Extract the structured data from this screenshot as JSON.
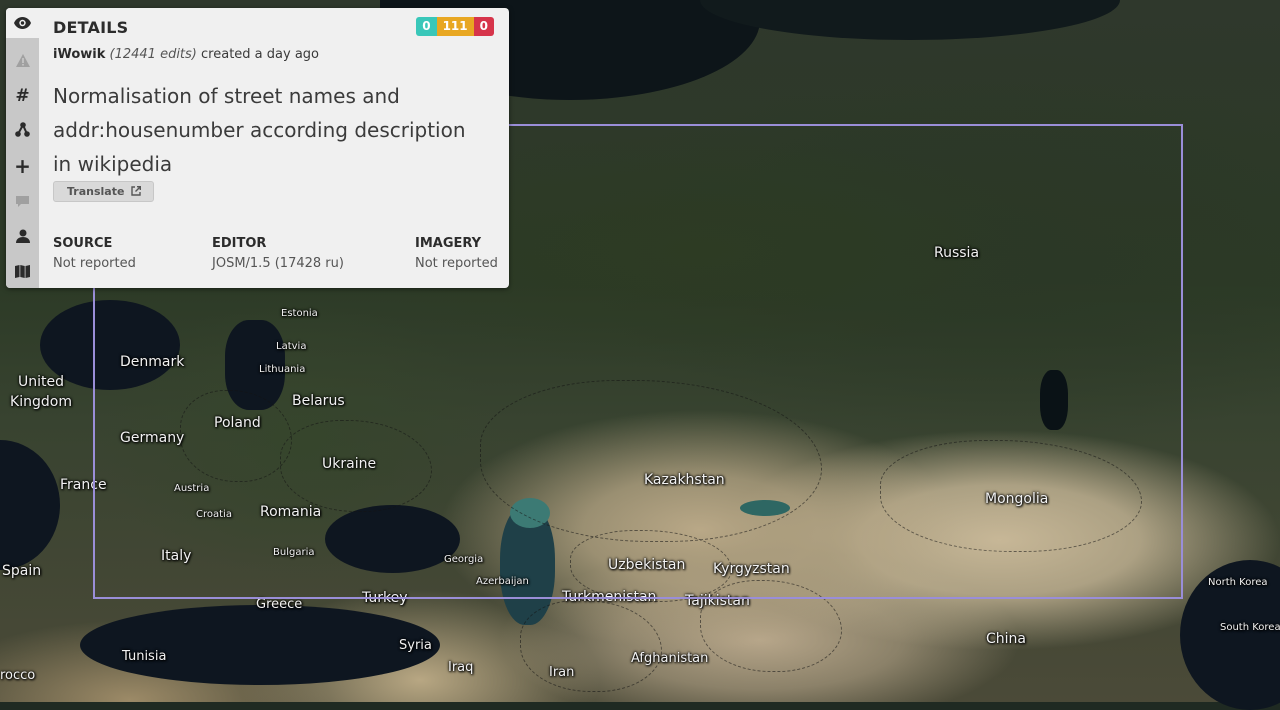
{
  "panel": {
    "title": "DETAILS",
    "badges": {
      "created": "0",
      "modified": "111",
      "deleted": "0"
    },
    "user": "iWowik",
    "edits": "(12441 edits)",
    "created_text": "created a day ago",
    "comment": "Normalisation of street names and addr:housenumber according description in wikipedia",
    "translate_label": "Translate",
    "source_label": "SOURCE",
    "source_value": "Not reported",
    "editor_label": "EDITOR",
    "editor_value": "JOSM/1.5 (17428 ru)",
    "imagery_label": "IMAGERY",
    "imagery_value": "Not reported"
  },
  "rail_icons": [
    "eye-icon",
    "warning-icon",
    "hashtag-icon",
    "geometry-icon",
    "plus-icon",
    "comment-icon",
    "user-icon",
    "map-icon"
  ],
  "map_labels": {
    "russia": "Russia",
    "estonia": "Estonia",
    "latvia": "Latvia",
    "lithuania": "Lithuania",
    "denmark": "Denmark",
    "united_kingdom": "United Kingdom",
    "belarus": "Belarus",
    "poland": "Poland",
    "germany": "Germany",
    "ukraine": "Ukraine",
    "france": "France",
    "austria": "Austria",
    "croatia": "Croatia",
    "romania": "Romania",
    "bulgaria": "Bulgaria",
    "italy": "Italy",
    "spain": "Spain",
    "greece": "Greece",
    "turkey": "Turkey",
    "georgia": "Georgia",
    "azerbaijan": "Azerbaijan",
    "kazakhstan": "Kazakhstan",
    "uzbekistan": "Uzbekistan",
    "kyrgyzstan": "Kyrgyzstan",
    "turkmenistan": "Turkmenistan",
    "tajikistan": "Tajikistan",
    "mongolia": "Mongolia",
    "china": "China",
    "north_korea": "North Korea",
    "south_korea": "South Korea",
    "tunisia": "Tunisia",
    "syria": "Syria",
    "iraq": "Iraq",
    "iran": "Iran",
    "afghanistan": "Afghanistan",
    "morocco": "rocco"
  },
  "colors": {
    "bbox": "#9a8ed8",
    "badge_created": "#39c7b9",
    "badge_modified": "#e8a722",
    "badge_deleted": "#d6344a"
  }
}
